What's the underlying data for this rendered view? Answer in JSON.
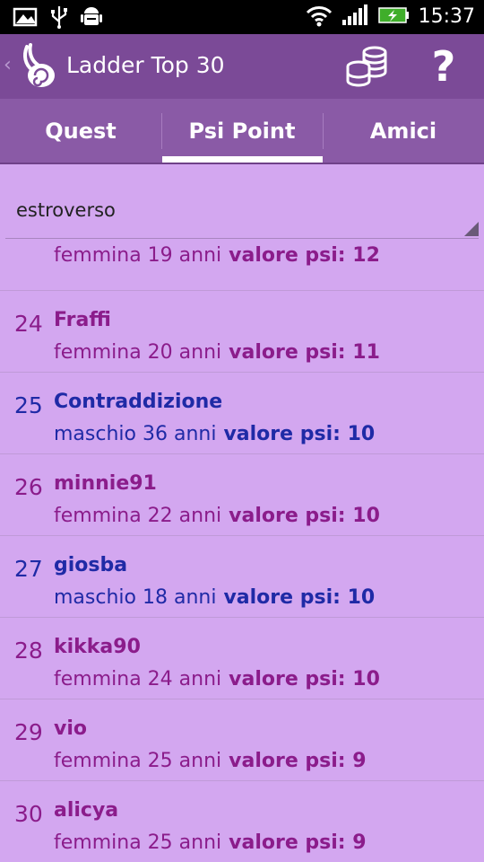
{
  "status_bar": {
    "time": "15:37",
    "icons": [
      "gallery-notification-icon",
      "usb-icon",
      "android-debug-icon",
      "wifi-icon",
      "signal-icon",
      "battery-charging-icon"
    ]
  },
  "action_bar": {
    "title": "Ladder Top 30",
    "back_icon": "chevron-left-icon",
    "logo_icon": "app-logo-icon",
    "coins_icon": "coins-icon",
    "help_label": "?"
  },
  "tabs": [
    {
      "label": "Quest"
    },
    {
      "label": "Psi Point"
    },
    {
      "label": "Amici"
    }
  ],
  "selected_tab": "Psi Point",
  "filter": {
    "selected": "estroverso"
  },
  "colors": {
    "female": "#8b1c8b",
    "male": "#1f2aa6",
    "action_bar": "#7b4a97",
    "tab_bar": "#8a5aa6",
    "background": "#d3a7f0"
  },
  "list": {
    "value_label": "valore psi:",
    "first_partial": {
      "meta": "femmina 19 anni",
      "value": "12"
    },
    "rows": [
      {
        "rank": "24",
        "name": "Fraffi",
        "meta": "femmina 20 anni",
        "value": "11",
        "gender": "female"
      },
      {
        "rank": "25",
        "name": "Contraddizione",
        "meta": "maschio 36 anni",
        "value": "10",
        "gender": "male"
      },
      {
        "rank": "26",
        "name": "minnie91",
        "meta": "femmina 22 anni",
        "value": "10",
        "gender": "female"
      },
      {
        "rank": "27",
        "name": "giosba",
        "meta": "maschio 18 anni",
        "value": "10",
        "gender": "male"
      },
      {
        "rank": "28",
        "name": "kikka90",
        "meta": "femmina 24 anni",
        "value": "10",
        "gender": "female"
      },
      {
        "rank": "29",
        "name": "vio",
        "meta": "femmina 25 anni",
        "value": "9",
        "gender": "female"
      },
      {
        "rank": "30",
        "name": "alicya",
        "meta": "femmina 25 anni",
        "value": "9",
        "gender": "female"
      }
    ]
  }
}
